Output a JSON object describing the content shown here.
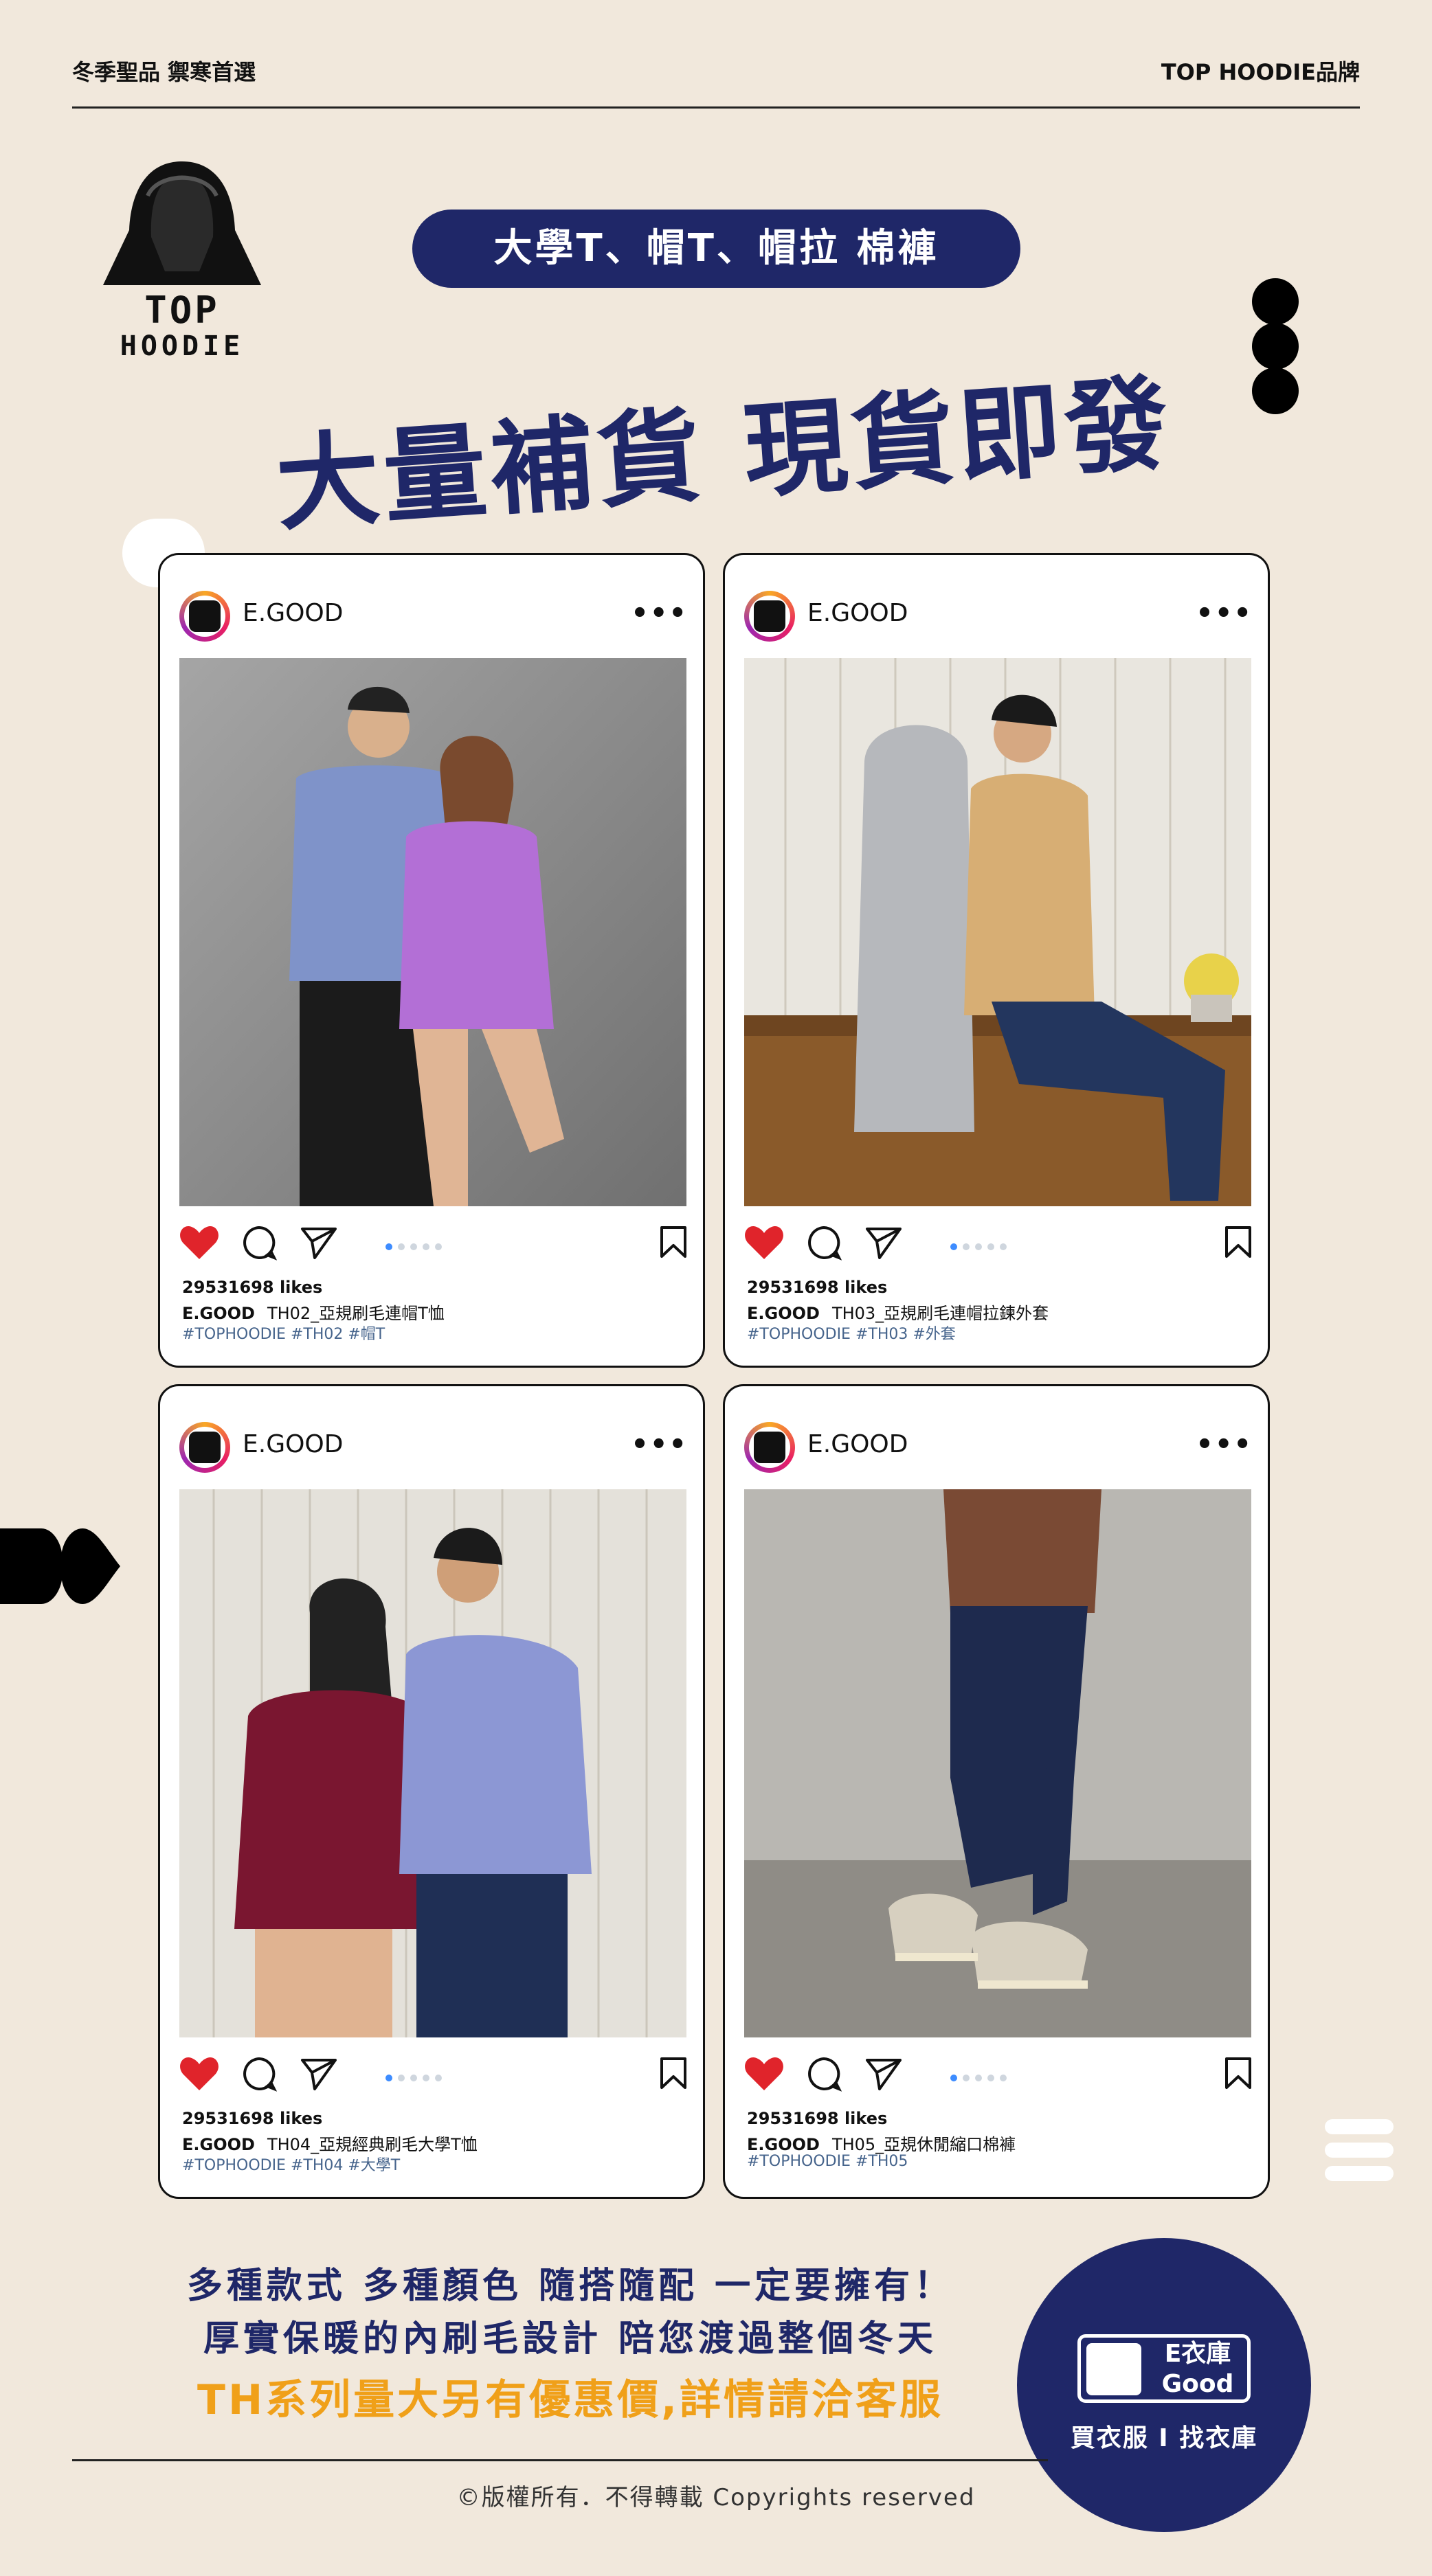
{
  "header": {
    "left_text": "冬季聖品 禦寒首選",
    "right_text": "TOP HOODIE品牌"
  },
  "brand_logo": {
    "line1": "TOP",
    "line2": "HOODIE"
  },
  "pill_label": "大學T、帽T、帽拉 棉褲",
  "headline": "大量補貨  現貨即發",
  "posts": [
    {
      "username": "E.GOOD",
      "likes": "29531698 likes",
      "caption_user": "E.GOOD",
      "caption_text": "TH02_亞規刷毛連帽T恤",
      "tags": "#TOPHOODIE #TH02 #帽T"
    },
    {
      "username": "E.GOOD",
      "likes": "29531698 likes",
      "caption_user": "E.GOOD",
      "caption_text": "TH03_亞規刷毛連帽拉鍊外套",
      "tags": "#TOPHOODIE #TH03 #外套"
    },
    {
      "username": "E.GOOD",
      "likes": "29531698 likes",
      "caption_user": "E.GOOD",
      "caption_text": "TH04_亞規經典刷毛大學T恤",
      "tags": "#TOPHOODIE #TH04 #大學T"
    },
    {
      "username": "E.GOOD",
      "likes": "29531698 likes",
      "caption_user": "E.GOOD",
      "caption_text": "TH05_亞規休閒縮口棉褲",
      "tags": "#TOPHOODIE #TH05"
    }
  ],
  "footer": {
    "line1": "多種款式 多種顏色 隨搭隨配  一定要擁有！",
    "line2": "厚實保暖的內刷毛設計 陪您渡過整個冬天",
    "line3": "TH系列量大另有優惠價,詳情請洽客服",
    "copyright": "©版權所有．不得轉載 Copyrights reserved"
  },
  "store_badge": {
    "brand": "E衣庫 Good",
    "slogan": "買衣服 I 找衣庫"
  },
  "colors": {
    "navy": "#1f2768",
    "orange": "#f0a019",
    "background": "#f1e8dc",
    "heart": "#e0242b"
  }
}
